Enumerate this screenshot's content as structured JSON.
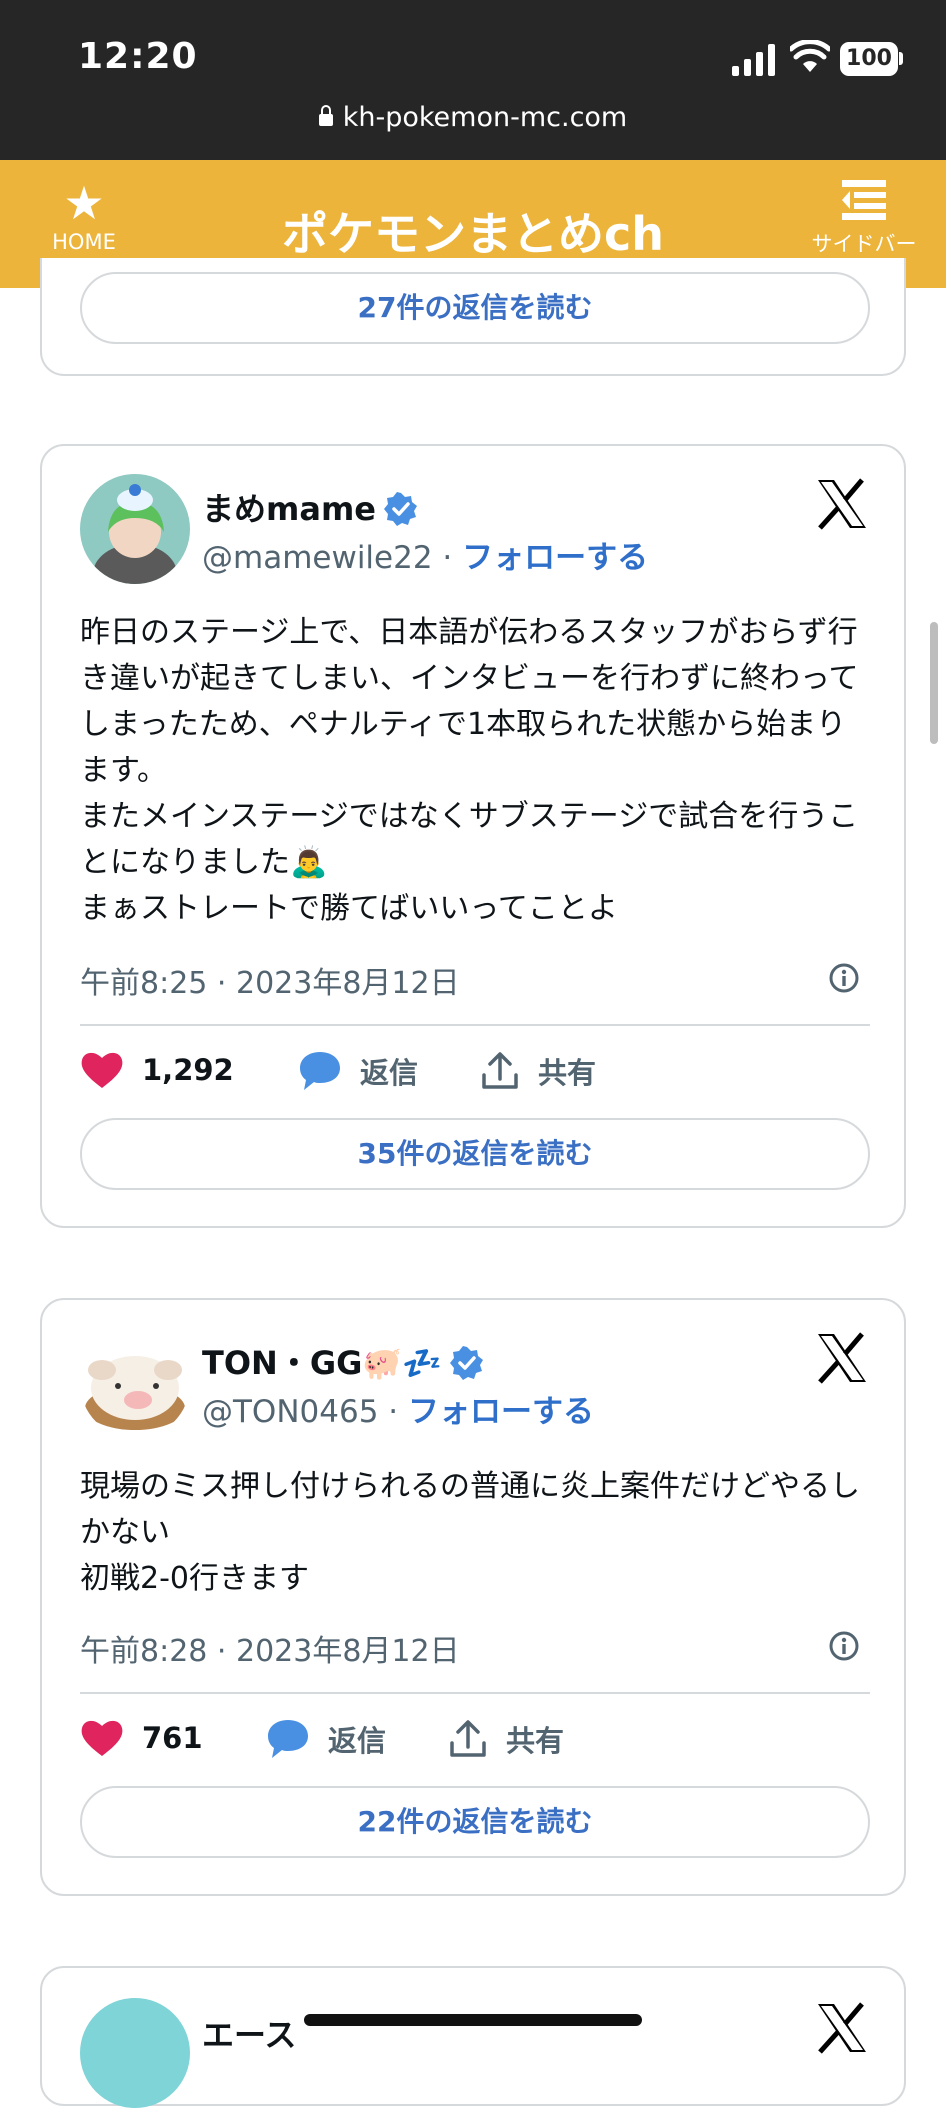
{
  "status_bar": {
    "time": "12:20",
    "battery": "100",
    "url": "kh-pokemon-mc.com"
  },
  "header": {
    "home_label": "HOME",
    "title": "ポケモンまとめch",
    "sidebar_label": "サイドバー"
  },
  "prev_card": {
    "read_replies": "27件の返信を読む"
  },
  "posts": [
    {
      "name": "まめmame",
      "handle": "@mamewile22",
      "separator": " · ",
      "follow": "フォローする",
      "text": "昨日のステージ上で、日本語が伝わるスタッフがおらず行き違いが起きてしまい、インタビューを行わずに終わってしまったため、ペナルティで1本取られた状態から始まります。\nまたメインステージではなくサブステージで試合を行うことになりました🙇‍♂️\nまぁストレートで勝てばいいってことよ",
      "timestamp": "午前8:25 · 2023年8月12日",
      "likes": "1,292",
      "reply_label": "返信",
      "share_label": "共有",
      "read_replies": "35件の返信を読む"
    },
    {
      "name": "TON・GG🐖💤",
      "handle": "@TON0465",
      "separator": " · ",
      "follow": "フォローする",
      "text": "現場のミス押し付けられるの普通に炎上案件だけどやるしかない\n初戦2-0行きます",
      "timestamp": "午前8:28 · 2023年8月12日",
      "likes": "761",
      "reply_label": "返信",
      "share_label": "共有",
      "read_replies": "22件の返信を読む"
    },
    {
      "name": "エース"
    }
  ],
  "colors": {
    "header_bg": "#ecb43a",
    "status_bg": "#262626",
    "link": "#2f6fc9",
    "like": "#e0245e",
    "reply_icon": "#4a90e2"
  },
  "icons": [
    "star-icon",
    "sidebar-menu-icon",
    "verified-icon",
    "x-logo-icon",
    "info-icon",
    "heart-icon",
    "reply-bubble-icon",
    "share-icon"
  ]
}
